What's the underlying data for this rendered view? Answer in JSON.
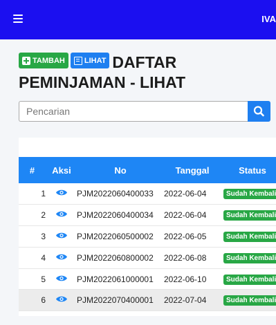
{
  "topbar": {
    "menu_icon": "hamburger-icon",
    "user_label": "IVA"
  },
  "heading": {
    "add_label": "TAMBAH",
    "view_label": "LIHAT",
    "title_line1": "DAFTAR",
    "title_line2": "PEMINJAMAN - LIHAT"
  },
  "search": {
    "placeholder": "Pencarian",
    "value": "",
    "icon": "search-icon"
  },
  "table": {
    "headers": {
      "num": "#",
      "aksi": "Aksi",
      "no": "No",
      "tanggal": "Tanggal",
      "status": "Status"
    },
    "rows": [
      {
        "num": "1",
        "no": "PJM2022060400033",
        "tanggal": "2022-06-04",
        "status": "Sudah Kembali"
      },
      {
        "num": "2",
        "no": "PJM2022060400034",
        "tanggal": "2022-06-04",
        "status": "Sudah Kembali"
      },
      {
        "num": "3",
        "no": "PJM2022060500002",
        "tanggal": "2022-06-05",
        "status": "Sudah Kembali"
      },
      {
        "num": "4",
        "no": "PJM2022060800002",
        "tanggal": "2022-06-08",
        "status": "Sudah Kembali"
      },
      {
        "num": "5",
        "no": "PJM2022061000001",
        "tanggal": "2022-06-10",
        "status": "Sudah Kembali"
      },
      {
        "num": "6",
        "no": "PJM2022070400001",
        "tanggal": "2022-07-04",
        "status": "Sudah Kembali"
      }
    ]
  },
  "colors": {
    "topbar": "#1b0ff0",
    "primary": "#1e7ff0",
    "success": "#28a745",
    "header": "#1e86f5"
  }
}
